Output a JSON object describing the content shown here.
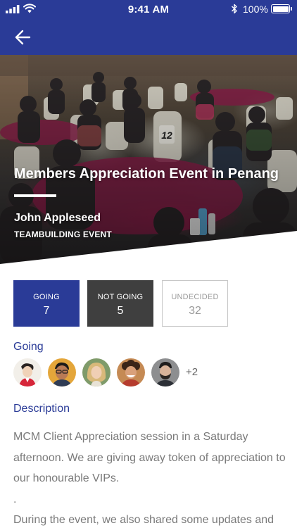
{
  "status_bar": {
    "time": "9:41 AM",
    "battery": "100%",
    "battery_level": 1.0,
    "icons": [
      "signal-icon",
      "wifi-icon",
      "bluetooth-icon",
      "battery-icon"
    ]
  },
  "app_bar": {
    "background": "#2a3b97",
    "back_icon": "arrow-left-icon"
  },
  "event": {
    "title": "Members Appreciation Event in Penang",
    "author": "John Appleseed",
    "category": "TEAMBUILDING EVENT"
  },
  "rsvp": {
    "going": {
      "label": "GOING",
      "count": "7",
      "color": "#2a3b97"
    },
    "not_going": {
      "label": "NOT GOING",
      "count": "5",
      "color": "#3f3f3f"
    },
    "undecided": {
      "label": "UNDECIDED",
      "count": "32"
    }
  },
  "attendees": {
    "title": "Going",
    "avatars": [
      {
        "icon": "avatar-illustrated-man-icon"
      },
      {
        "icon": "avatar-man-glasses-icon"
      },
      {
        "icon": "avatar-blonde-woman-icon"
      },
      {
        "icon": "avatar-curly-hair-man-icon"
      },
      {
        "icon": "avatar-bearded-man-icon"
      }
    ],
    "more": "+2"
  },
  "description": {
    "title": "Description",
    "lines": [
      "MCM Client Appreciation session in a Saturday afternoon. We are giving away token of appreciation to our honourable VIPs.",
      ".",
      "During the event, we also shared some updates and"
    ]
  }
}
